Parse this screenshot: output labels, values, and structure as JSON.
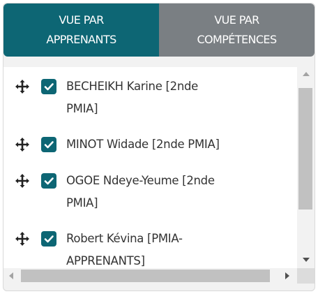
{
  "tabs": [
    {
      "line1": "VUE PAR",
      "line2": "APPRENANTS",
      "active": true
    },
    {
      "line1": "VUE PAR",
      "line2": "COMPÉTENCES",
      "active": false
    }
  ],
  "list": {
    "items": [
      {
        "line1": "BECHEIKH Karine [2nde",
        "line2": "PMIA]",
        "checked": true
      },
      {
        "line1": "MINOT Widade [2nde PMIA]",
        "line2": "",
        "checked": true
      },
      {
        "line1": "OGOE Ndeye-Yeume [2nde",
        "line2": "PMIA]",
        "checked": true
      },
      {
        "line1": "Robert Kévina [PMIA-",
        "line2": "APPRENANTS]",
        "checked": true
      }
    ]
  },
  "icons": {
    "drag": "drag-move-icon",
    "check": "checkmark-icon"
  },
  "colors": {
    "active_tab": "#0d6674",
    "inactive_tab": "#7a7f83",
    "checkbox": "#0d6674",
    "text": "#333333"
  }
}
